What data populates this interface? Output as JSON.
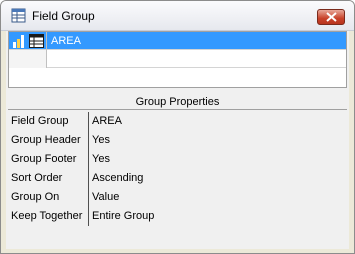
{
  "window": {
    "title": "Field Group",
    "icon": "field-group-icon",
    "close_icon": "close-icon"
  },
  "group_list": {
    "rows": [
      {
        "label": "AREA",
        "selected": true,
        "icons": [
          "bar-chart-icon",
          "table-icon"
        ]
      },
      {
        "label": "",
        "selected": false
      }
    ]
  },
  "properties": {
    "header": "Group Properties",
    "items": [
      {
        "name": "Field Group",
        "value": "AREA"
      },
      {
        "name": "Group Header",
        "value": "Yes"
      },
      {
        "name": "Group Footer",
        "value": "Yes"
      },
      {
        "name": "Sort Order",
        "value": "Ascending"
      },
      {
        "name": "Group On",
        "value": "Value"
      },
      {
        "name": "Keep Together",
        "value": "Entire Group"
      }
    ]
  },
  "colors": {
    "selection": "#3399ff",
    "close_button": "#c8422a"
  }
}
